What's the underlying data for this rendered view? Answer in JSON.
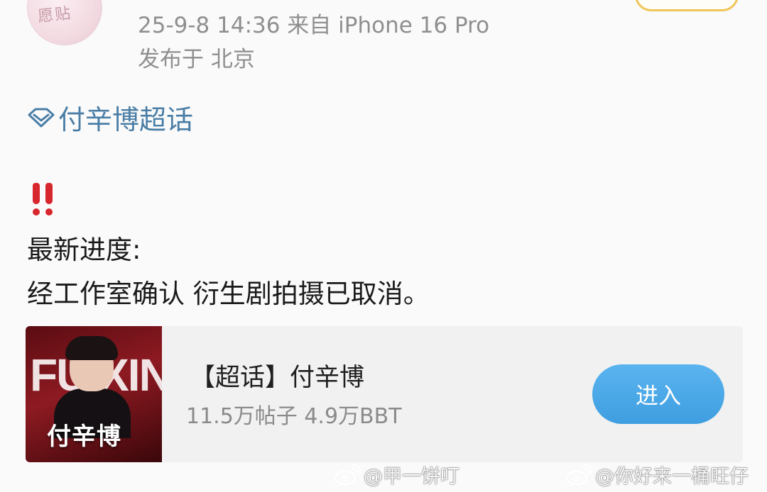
{
  "post": {
    "time_source": "25-9-8 14:36   来自 iPhone 16 Pro",
    "location": "发布于 北京",
    "avatar_text": "愿贴"
  },
  "topic": {
    "label": "付辛博超话",
    "icon": "diamond-icon",
    "color": "#4a7ea6"
  },
  "content": {
    "emoji": "double-exclamation-icon",
    "line1": "最新进度:",
    "line2": "经工作室确认 衍生剧拍摄已取消。"
  },
  "card": {
    "thumb_big_text": "FU XINBO",
    "thumb_name": "付辛博",
    "title": "【超话】付辛博",
    "stats": "11.5万帖子 4.9万BBT",
    "enter_label": "进入",
    "enter_color": "#4aa7e8"
  },
  "watermarks": [
    {
      "text": "@甲一饼叮",
      "icon": "weibo-icon"
    },
    {
      "text": "@你好来一桶旺仔",
      "icon": "weibo-icon"
    }
  ]
}
